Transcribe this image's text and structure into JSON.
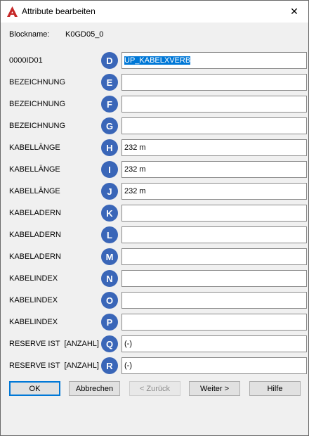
{
  "window": {
    "title": "Attribute bearbeiten",
    "close_glyph": "✕"
  },
  "blockname": {
    "label": "Blockname:",
    "value": "K0GD05_0"
  },
  "attributes": [
    {
      "label": "0000ID01",
      "letter": "D",
      "value": "ÜP_KABELXVERB",
      "selected": true
    },
    {
      "label": "BEZEICHNUNG",
      "letter": "E",
      "value": ""
    },
    {
      "label": "BEZEICHNUNG",
      "letter": "F",
      "value": ""
    },
    {
      "label": "BEZEICHNUNG",
      "letter": "G",
      "value": ""
    },
    {
      "label": "KABELLÄNGE",
      "letter": "H",
      "value": "232 m"
    },
    {
      "label": "KABELLÄNGE",
      "letter": "I",
      "value": "232 m"
    },
    {
      "label": "KABELLÄNGE",
      "letter": "J",
      "value": "232 m"
    },
    {
      "label": "KABELADERN",
      "letter": "K",
      "value": ""
    },
    {
      "label": "KABELADERN",
      "letter": "L",
      "value": ""
    },
    {
      "label": "KABELADERN",
      "letter": "M",
      "value": ""
    },
    {
      "label": "KABELINDEX",
      "letter": "N",
      "value": ""
    },
    {
      "label": "KABELINDEX",
      "letter": "O",
      "value": ""
    },
    {
      "label": "KABELINDEX",
      "letter": "P",
      "value": ""
    },
    {
      "label": "RESERVE IST  [ANZAHL]",
      "letter": "Q",
      "value": "(-)"
    },
    {
      "label": "RESERVE IST  [ANZAHL]",
      "letter": "R",
      "value": "(-)"
    }
  ],
  "buttons": {
    "ok": "OK",
    "cancel": "Abbrechen",
    "back": "< Zurück",
    "next": "Weiter >",
    "help": "Hilfe"
  },
  "colors": {
    "letter_badge": "#3a66b8",
    "selection": "#0078d7",
    "app_icon": "#c62828"
  },
  "icons": {
    "app": "autocad-icon",
    "close": "close-icon"
  }
}
